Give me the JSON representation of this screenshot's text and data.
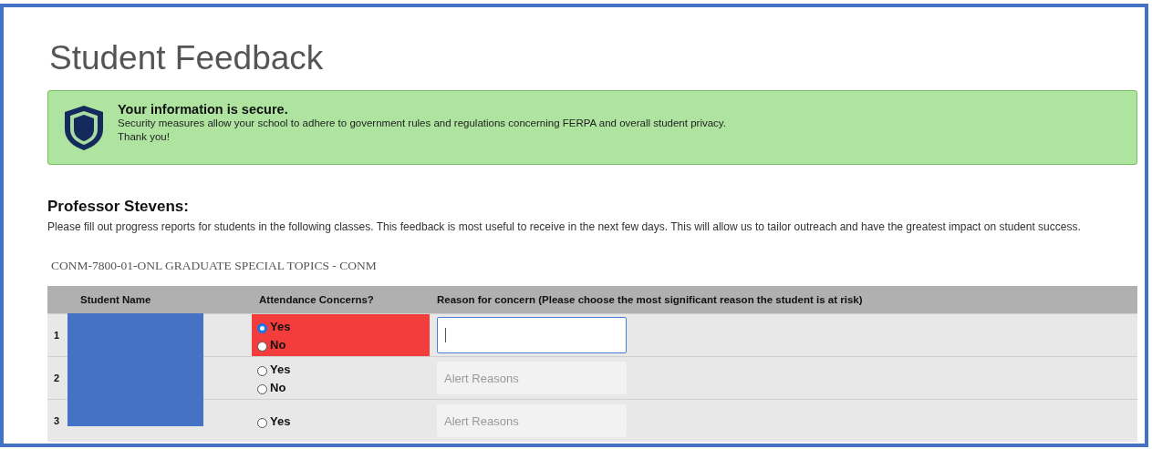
{
  "page_title": "Student Feedback",
  "alert": {
    "heading": "Your information is secure.",
    "lines": [
      "Security measures allow your school to adhere to government rules and regulations concerning FERPA and overall student privacy.",
      "Thank you!"
    ]
  },
  "greeting": "Professor Stevens:",
  "intro": "Please fill out progress reports for students in the following classes.  This feedback is most useful to receive in the next few days.  This will allow us to tailor outreach and have the greatest impact on student success.",
  "course": "CONM-7800-01-ONL GRADUATE SPECIAL TOPICS - CONM",
  "table": {
    "columns": [
      "Student Name",
      "Attendance Concerns?",
      "Reason for concern (Please choose the most significant reason the student is at risk)"
    ],
    "rows": [
      {
        "number": "1",
        "flagged": true,
        "options": [
          {
            "label": "Yes",
            "selected": true
          },
          {
            "label": "No",
            "selected": false
          }
        ],
        "reason": {
          "focused": true
        }
      },
      {
        "number": "2",
        "flagged": false,
        "options": [
          {
            "label": "Yes",
            "selected": false
          },
          {
            "label": "No",
            "selected": false
          }
        ],
        "reason": {
          "placeholder": "Alert Reasons",
          "focused": false
        }
      },
      {
        "number": "3",
        "flagged": false,
        "options": [
          {
            "label": "Yes",
            "selected": false
          }
        ],
        "reason": {
          "placeholder": "Alert Reasons",
          "focused": false
        }
      }
    ]
  }
}
